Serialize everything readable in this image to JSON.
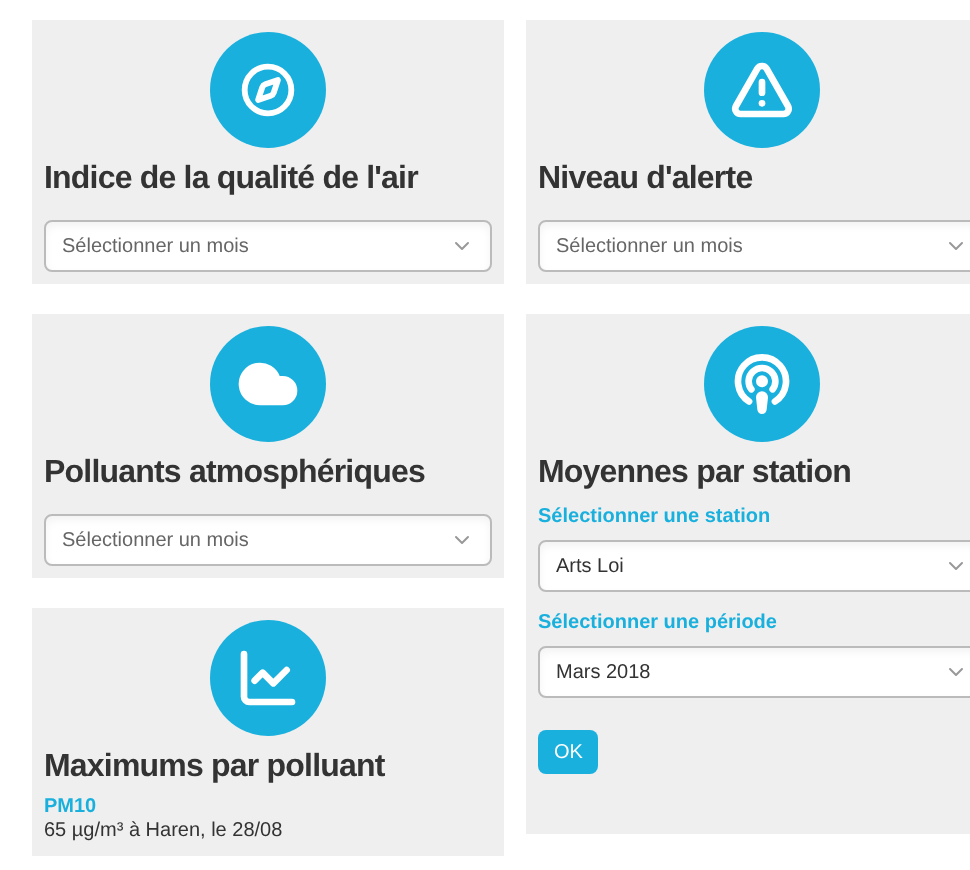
{
  "cards": [
    {
      "kind": "month_select",
      "title": "Indice de la qualité de l'air",
      "select": {
        "placeholder": "Sélectionner un mois"
      }
    },
    {
      "kind": "month_select",
      "title": "Niveau d'alerte",
      "select": {
        "placeholder": "Sélectionner un mois"
      }
    },
    {
      "kind": "month_select",
      "title": "Polluants atmosphériques",
      "select": {
        "placeholder": "Sélectionner un mois"
      }
    },
    {
      "kind": "station_form",
      "title": "Moyennes par station",
      "fields": [
        {
          "label": "Sélectionner une station",
          "value": "Arts Loi"
        },
        {
          "label": "Sélectionner une période",
          "value": "Mars 2018"
        }
      ],
      "button": "OK"
    },
    {
      "kind": "maximums",
      "title": "Maximums par polluant",
      "items": [
        {
          "name": "PM10",
          "detail": "65 µg/m³ à Haren, le 28/08"
        }
      ]
    }
  ]
}
